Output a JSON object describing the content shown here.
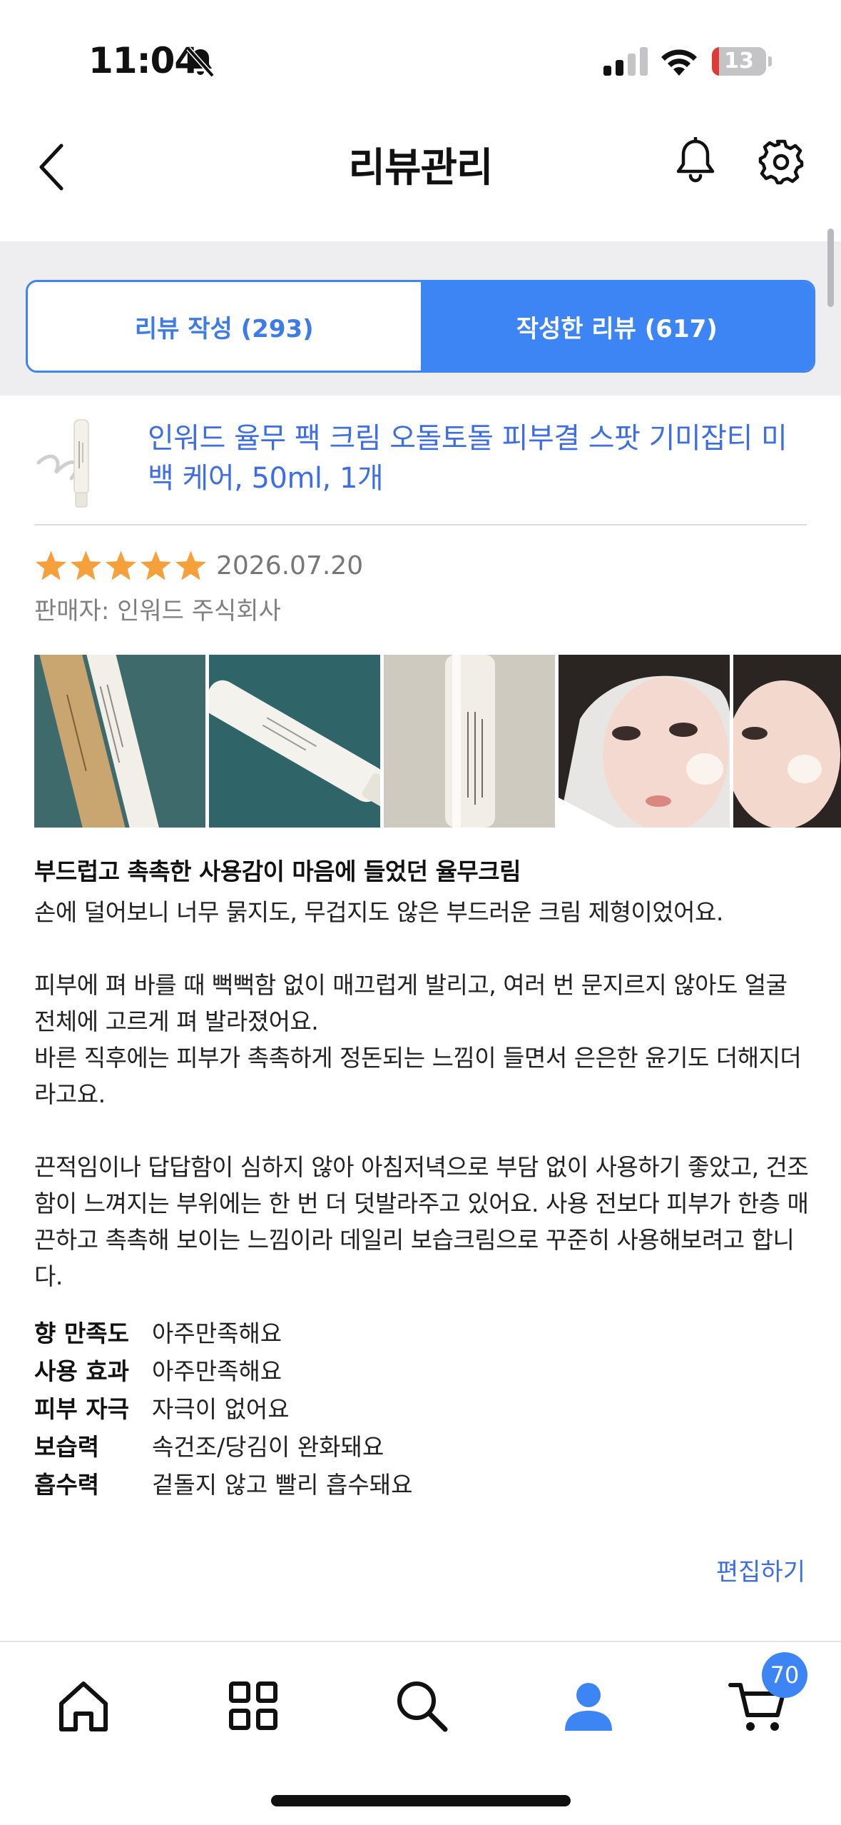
{
  "status_bar": {
    "time": "11:04",
    "battery": "13",
    "battery_level": 0.13
  },
  "header": {
    "title": "리뷰관리"
  },
  "tabs": [
    {
      "label": "리뷰 작성 (293)",
      "active": false
    },
    {
      "label": "작성한 리뷰 (617)",
      "active": true
    }
  ],
  "product": {
    "name": "인워드 율무 팩 크림 오돌토돌 피부결 스팟 기미잡티 미백 케어, 50ml, 1개"
  },
  "review": {
    "rating": 5,
    "date": "2026.07.20",
    "seller": "판매자: 인워드 주식회사",
    "title": "부드럽고 촉촉한 사용감이 마음에 들었던 율무크림",
    "body": "손에 덜어보니 너무 묽지도, 무겁지도 않은 부드러운 크림 제형이었어요.\n\n피부에 펴 바를 때 뻑뻑함 없이 매끄럽게 발리고, 여러 번 문지르지 않아도 얼굴 전체에 고르게 펴 발라졌어요.\n바른 직후에는 피부가 촉촉하게 정돈되는 느낌이 들면서 은은한 윤기도 더해지더라고요.\n\n끈적임이나 답답함이 심하지 않아 아침저녁으로 부담 없이 사용하기 좋았고, 건조함이 느껴지는 부위에는 한 번 더 덧발라주고 있어요. 사용 전보다 피부가 한층 매끈하고 촉촉해 보이는 느낌이라 데일리 보습크림으로 꾸준히 사용해보려고 합니다.",
    "attributes": [
      {
        "key": "향 만족도",
        "value": "아주만족해요"
      },
      {
        "key": "사용 효과",
        "value": "아주만족해요"
      },
      {
        "key": "피부 자극",
        "value": "자극이 없어요"
      },
      {
        "key": "보습력",
        "value": "속건조/당김이 완화돼요"
      },
      {
        "key": "흡수력",
        "value": "겉돌지 않고 빨리 흡수돼요"
      }
    ],
    "edit_label": "편집하기"
  },
  "bottom_nav": {
    "items": [
      "home-icon",
      "category-icon",
      "search-icon",
      "profile-icon",
      "cart-icon"
    ],
    "cart_count": "70"
  },
  "colors": {
    "accent": "#3d84f4",
    "link": "#3d6ee6",
    "star": "#f5a03a",
    "battery_low": "#e03a36"
  }
}
